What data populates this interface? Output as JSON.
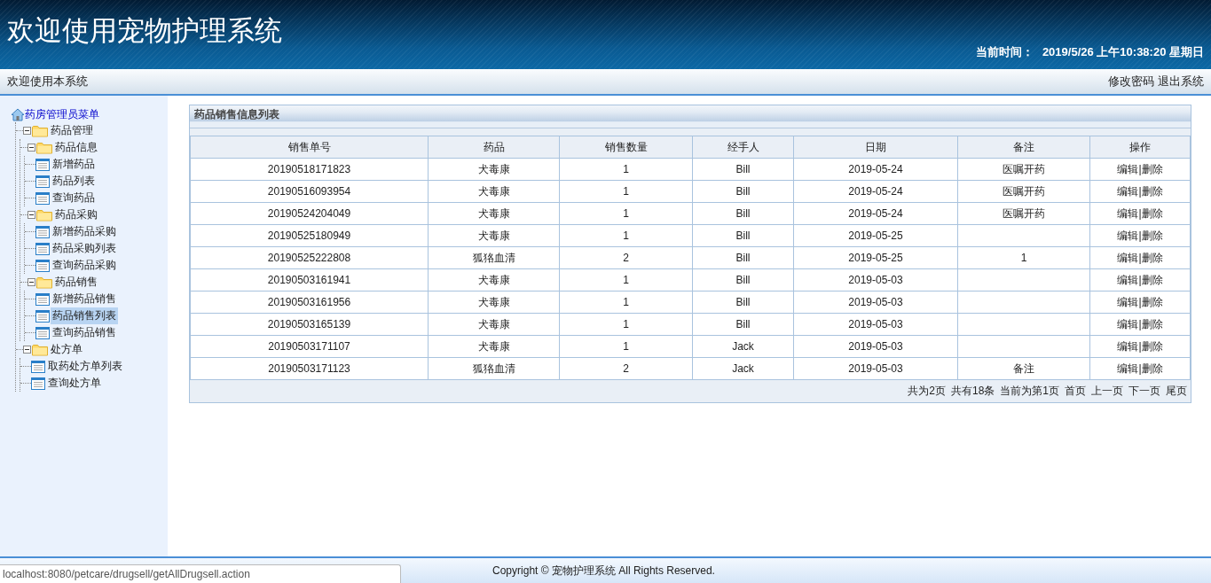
{
  "header": {
    "title": "欢迎使用宠物护理系统",
    "time_label": "当前时间：",
    "time_value": "2019/5/26 上午10:38:20 星期日"
  },
  "top_bar": {
    "welcome": "欢迎使用本系统",
    "links": [
      "修改密码",
      "退出系统"
    ]
  },
  "sidebar": {
    "root": "药房管理员菜单",
    "items": [
      {
        "label": "药品管理",
        "kind": "folder",
        "expanded": true,
        "children": [
          {
            "label": "药品信息",
            "kind": "folder",
            "expanded": true,
            "children": [
              {
                "label": "新增药品",
                "kind": "page",
                "selected": false
              },
              {
                "label": "药品列表",
                "kind": "page",
                "selected": false
              },
              {
                "label": "查询药品",
                "kind": "page",
                "selected": false
              }
            ]
          },
          {
            "label": "药品采购",
            "kind": "folder",
            "expanded": true,
            "children": [
              {
                "label": "新增药品采购",
                "kind": "page",
                "selected": false
              },
              {
                "label": "药品采购列表",
                "kind": "page",
                "selected": false
              },
              {
                "label": "查询药品采购",
                "kind": "page",
                "selected": false
              }
            ]
          },
          {
            "label": "药品销售",
            "kind": "folder",
            "expanded": true,
            "children": [
              {
                "label": "新增药品销售",
                "kind": "page",
                "selected": false
              },
              {
                "label": "药品销售列表",
                "kind": "page",
                "selected": true
              },
              {
                "label": "查询药品销售",
                "kind": "page",
                "selected": false
              }
            ]
          }
        ]
      },
      {
        "label": "处方单",
        "kind": "folder",
        "expanded": true,
        "children": [
          {
            "label": "取药处方单列表",
            "kind": "page",
            "selected": false
          },
          {
            "label": "查询处方单",
            "kind": "page",
            "selected": false
          }
        ]
      }
    ]
  },
  "panel": {
    "title": "药品销售信息列表",
    "table": {
      "columns": [
        "销售单号",
        "药品",
        "销售数量",
        "经手人",
        "日期",
        "备注",
        "操作"
      ],
      "action_separator": "|",
      "rows": [
        {
          "cells": [
            "20190518171823",
            "犬毒康",
            "1",
            "Bill",
            "2019-05-24",
            "医嘱开药"
          ],
          "actions": [
            "编辑",
            "删除"
          ]
        },
        {
          "cells": [
            "20190516093954",
            "犬毒康",
            "1",
            "Bill",
            "2019-05-24",
            "医嘱开药"
          ],
          "actions": [
            "编辑",
            "删除"
          ]
        },
        {
          "cells": [
            "20190524204049",
            "犬毒康",
            "1",
            "Bill",
            "2019-05-24",
            "医嘱开药"
          ],
          "actions": [
            "编辑",
            "删除"
          ]
        },
        {
          "cells": [
            "20190525180949",
            "犬毒康",
            "1",
            "Bill",
            "2019-05-25",
            ""
          ],
          "actions": [
            "编辑",
            "删除"
          ]
        },
        {
          "cells": [
            "20190525222808",
            "狐狢血清",
            "2",
            "Bill",
            "2019-05-25",
            "1"
          ],
          "actions": [
            "编辑",
            "删除"
          ]
        },
        {
          "cells": [
            "20190503161941",
            "犬毒康",
            "1",
            "Bill",
            "2019-05-03",
            ""
          ],
          "actions": [
            "编辑",
            "删除"
          ]
        },
        {
          "cells": [
            "20190503161956",
            "犬毒康",
            "1",
            "Bill",
            "2019-05-03",
            ""
          ],
          "actions": [
            "编辑",
            "删除"
          ]
        },
        {
          "cells": [
            "20190503165139",
            "犬毒康",
            "1",
            "Bill",
            "2019-05-03",
            ""
          ],
          "actions": [
            "编辑",
            "删除"
          ]
        },
        {
          "cells": [
            "20190503171107",
            "犬毒康",
            "1",
            "Jack",
            "2019-05-03",
            ""
          ],
          "actions": [
            "编辑",
            "删除"
          ]
        },
        {
          "cells": [
            "20190503171123",
            "狐狢血清",
            "2",
            "Jack",
            "2019-05-03",
            "备注"
          ],
          "actions": [
            "编辑",
            "删除"
          ]
        }
      ]
    },
    "pagination": {
      "info": [
        "共为2页",
        "共有18条",
        "当前为第1页"
      ],
      "links": [
        "首页",
        "上一页",
        "下一页",
        "尾页"
      ]
    }
  },
  "footer": {
    "copyright": "Copyright © 宠物护理系统 All Rights Reserved."
  },
  "status_url": "localhost:8080/petcare/drugsell/getAllDrugsell.action"
}
